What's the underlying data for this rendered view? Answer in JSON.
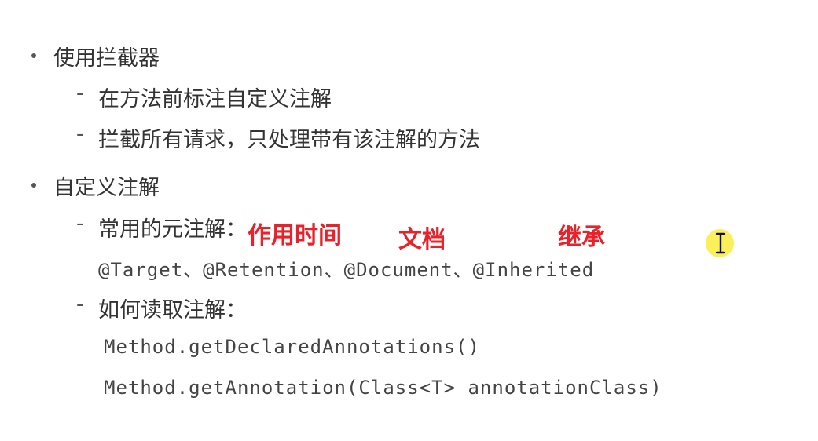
{
  "sections": [
    {
      "title": "使用拦截器",
      "items": [
        {
          "text": "在方法前标注自定义注解"
        },
        {
          "text": "拦截所有请求，只处理带有该注解的方法"
        }
      ]
    },
    {
      "title": "自定义注解",
      "items": [
        {
          "text": "常用的元注解：",
          "code": "@Target、@Retention、@Document、@Inherited"
        },
        {
          "text": "如何读取注解：",
          "code_lines": [
            "Method.getDeclaredAnnotations()",
            "Method.getAnnotation(Class<T> annotationClass)"
          ]
        }
      ]
    }
  ],
  "annotations": {
    "target_note": "作用时间",
    "document_note": "文档",
    "inherited_note": "继承"
  },
  "bullet_marker": "-",
  "colors": {
    "annotation": "#e8222a",
    "cursor_highlight": "#fbf05a"
  },
  "icons": {
    "cursor": "text-cursor-icon"
  }
}
